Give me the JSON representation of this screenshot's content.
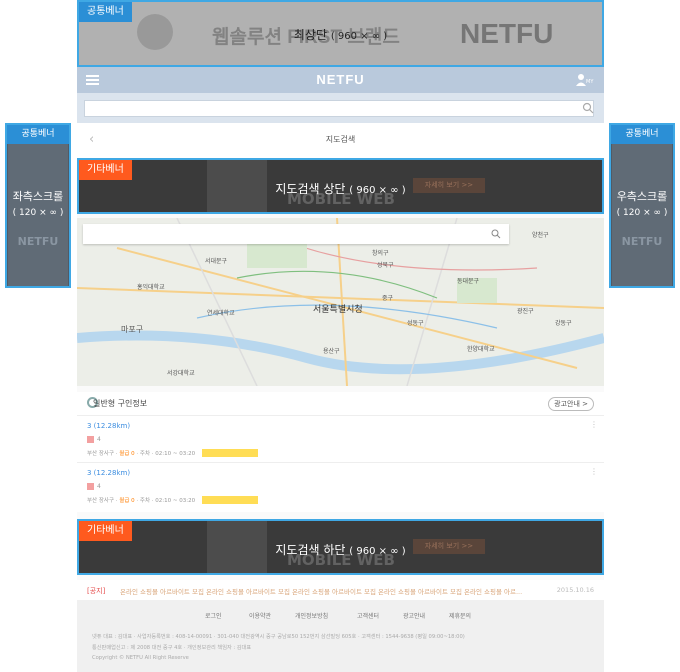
{
  "top_banner": {
    "tag": "공통베너",
    "label": "최상단",
    "size": "( 960 × ∞ )",
    "bg_text_left": "웹솔루션 FIRST 브랜드",
    "bg_text_right": "NETFU"
  },
  "header": {
    "logo": "NETFU",
    "user_badge": "MY"
  },
  "search": {
    "placeholder": ""
  },
  "subheader": {
    "back": "‹",
    "title": "지도검색"
  },
  "middle_banner": {
    "tag": "기타베너",
    "label": "지도검색 상단",
    "size": "( 960 × ∞ )",
    "bg_text": "MOBILE WEB",
    "bg_button": "자세히 보기 >>"
  },
  "map": {
    "labels": [
      {
        "text": "창의구"
      },
      {
        "text": "양천구"
      },
      {
        "text": "서대문구"
      },
      {
        "text": "성북구"
      },
      {
        "text": "동대문구"
      },
      {
        "text": "광진구"
      },
      {
        "text": "마포구"
      },
      {
        "text": "중구"
      },
      {
        "text": "서울특별시청"
      },
      {
        "text": "성동구"
      },
      {
        "text": "용산구"
      },
      {
        "text": "강동구"
      },
      {
        "text": "연세대학교"
      },
      {
        "text": "홍익대학교"
      },
      {
        "text": "서강대학교"
      },
      {
        "text": "한양대학교"
      }
    ]
  },
  "joblist": {
    "title": "일반형 구인정보",
    "ad_info": "광고안내 >",
    "items": [
      {
        "title": "3 (12.28km)",
        "count": "4",
        "meta_prefix": "부산 장사구 ·",
        "pay": "월급 0",
        "meta_suffix": "· 주차 · 02:10 ~ 03:20"
      },
      {
        "title": "3 (12.28km)",
        "count": "4",
        "meta_prefix": "부산 장사구 ·",
        "pay": "월급 0",
        "meta_suffix": "· 주차 · 02:10 ~ 03:20"
      }
    ]
  },
  "bottom_banner": {
    "tag": "기타베너",
    "label": "지도검색 하단",
    "size": "( 960 × ∞ )",
    "bg_text": "MOBILE WEB",
    "bg_button": "자세히 보기 >>"
  },
  "notice": {
    "label": "[공지]",
    "text": "온라인 쇼핑몰 아르바이트 모집 온라인 쇼핑몰 아르바이트 모집 온라인 쇼핑몰 아르바이트 모집 온라인 쇼핑몰 아르바이트 모집 온라인 쇼핑몰 아르...",
    "date": "2015.10.16"
  },
  "footer": {
    "links": [
      "로그인",
      "이용약관",
      "개인정보방침",
      "고객센터",
      "광고안내",
      "제휴문의"
    ],
    "info_line1": "넷퓨 대표 : 김대표 · 사업자등록번호 : 408-14-00091 · 301-040 대전광역시 중구 공남로50 152번지 삼선빌딩 605호 · 고객센터 : 1544-9638 (평일 09:00~18:00)",
    "info_line2": "통신판매업신고 : 제 2008 대전 중구 4호 · 개인정보관리 책임자 : 김대표",
    "info_line3": "Copyright © NETFU All Right Reserve"
  },
  "left_side": {
    "tag": "공통베너",
    "label": "좌측스크롤",
    "size": "( 120 × ∞ )",
    "bg_text": "NETFU"
  },
  "right_side": {
    "tag": "공통베너",
    "label": "우측스크롤",
    "size": "( 120 × ∞ )",
    "bg_text": "NETFU"
  },
  "colors": {
    "overlay_border": "#3fa8e4",
    "tag_blue": "#2b8fd6",
    "tag_red": "#ff5a1e",
    "header_bg": "#b9c9dc"
  }
}
